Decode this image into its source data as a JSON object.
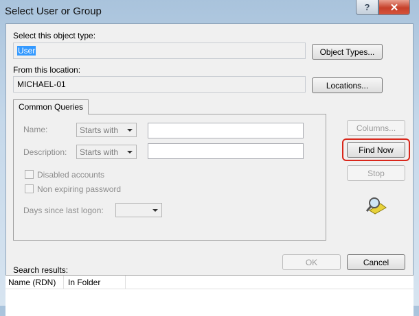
{
  "window": {
    "title": "Select User or Group",
    "help": "?",
    "close": "✕"
  },
  "object_type": {
    "label": "Select this object type:",
    "value": "User",
    "button": "Object Types..."
  },
  "location": {
    "label": "From this location:",
    "value": "MICHAEL-01",
    "button": "Locations..."
  },
  "tab": "Common Queries",
  "queries": {
    "name_label": "Name:",
    "name_mode": "Starts with",
    "desc_label": "Description:",
    "desc_mode": "Starts with",
    "disabled": "Disabled accounts",
    "nonexpiring": "Non expiring password",
    "days_label": "Days since last logon:"
  },
  "side": {
    "columns": "Columns...",
    "find": "Find Now",
    "stop": "Stop"
  },
  "footer": {
    "ok": "OK",
    "cancel": "Cancel",
    "results_label": "Search results:"
  },
  "columns": [
    "Name (RDN)",
    "In Folder"
  ],
  "colors": {
    "highlight": "#d9271b",
    "selection": "#3399ff"
  }
}
